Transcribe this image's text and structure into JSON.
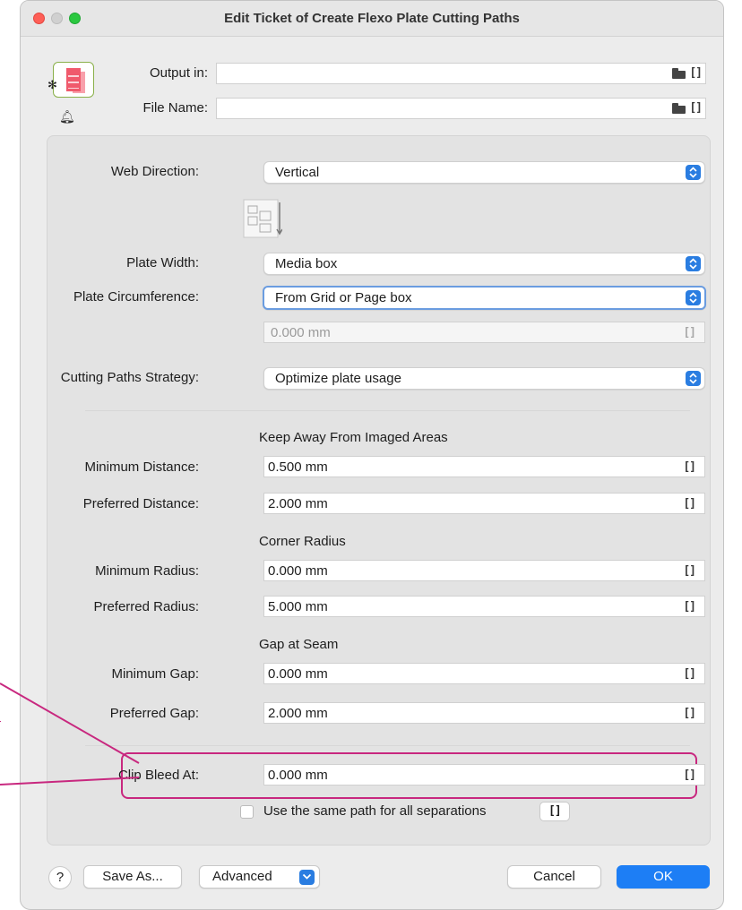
{
  "window": {
    "title": "Edit Ticket of Create Flexo Plate Cutting Paths"
  },
  "header": {
    "output_in_label": "Output in:",
    "output_in_value": "",
    "file_name_label": "File Name:",
    "file_name_value": ""
  },
  "form": {
    "web_direction": {
      "label": "Web Direction:",
      "value": "Vertical"
    },
    "plate_width": {
      "label": "Plate Width:",
      "value": "Media box"
    },
    "plate_circumference": {
      "label": "Plate Circumference:",
      "value": "From Grid or Page box",
      "disabled_value": "0.000 mm"
    },
    "cutting_strategy": {
      "label": "Cutting Paths Strategy:",
      "value": "Optimize plate usage"
    },
    "keep_away": {
      "heading": "Keep Away From Imaged Areas",
      "min_label": "Minimum Distance:",
      "min_value": "0.500 mm",
      "pref_label": "Preferred Distance:",
      "pref_value": "2.000 mm"
    },
    "corner_radius": {
      "heading": "Corner Radius",
      "min_label": "Minimum Radius:",
      "min_value": "0.000 mm",
      "pref_label": "Preferred Radius:",
      "pref_value": "5.000 mm"
    },
    "gap_at_seam": {
      "heading": "Gap at Seam",
      "min_label": "Minimum Gap:",
      "min_value": "0.000 mm",
      "pref_label": "Preferred Gap:",
      "pref_value": "2.000 mm"
    },
    "clip_bleed": {
      "label": "Clip Bleed At:",
      "value": "0.000 mm"
    },
    "same_path": {
      "label": "Use the same path for all separations",
      "checked": false
    }
  },
  "footer": {
    "help_label": "?",
    "save_as_label": "Save As...",
    "advanced_label": "Advanced",
    "cancel_label": "Cancel",
    "ok_label": "OK"
  },
  "icons": {
    "folder": "folder-icon",
    "variable": "variable-bracket-icon",
    "bell": "bell-icon",
    "gear": "gear-icon",
    "popup_stepper": "chevron-updown-icon"
  },
  "colors": {
    "accent_blue": "#1d7ef5",
    "callout_magenta": "#c8287f",
    "window_bg": "#ececec"
  }
}
